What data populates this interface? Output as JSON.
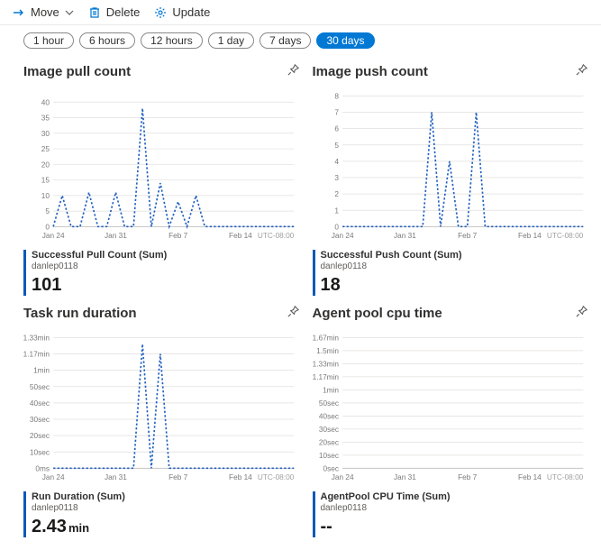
{
  "toolbar": {
    "move_label": "Move",
    "delete_label": "Delete",
    "update_label": "Update"
  },
  "time_ranges": [
    "1 hour",
    "6 hours",
    "12 hours",
    "1 day",
    "7 days",
    "30 days"
  ],
  "time_range_active_index": 5,
  "timezone_label": "UTC-08:00",
  "colors": {
    "series_primary": "#2060c0",
    "grid": "#e1dfdd",
    "axis_text": "#7a7a7a"
  },
  "charts": [
    {
      "title": "Image pull count",
      "metric_name": "Successful Pull Count (Sum)",
      "resource": "danlep0118",
      "value": "101",
      "unit": "",
      "chart_data": {
        "type": "line",
        "x": [
          "Jan 24",
          "Jan 25",
          "Jan 26",
          "Jan 27",
          "Jan 28",
          "Jan 29",
          "Jan 30",
          "Jan 31",
          "Feb 1",
          "Feb 2",
          "Feb 3",
          "Feb 4",
          "Feb 5",
          "Feb 6",
          "Feb 7",
          "Feb 8",
          "Feb 9",
          "Feb 10",
          "Feb 11",
          "Feb 12",
          "Feb 13",
          "Feb 14",
          "Feb 15",
          "Feb 16",
          "Feb 17",
          "Feb 18",
          "Feb 19",
          "Feb 20"
        ],
        "values": [
          0,
          10,
          0,
          0,
          11,
          0,
          0,
          11,
          0,
          0,
          38,
          0,
          14,
          0,
          8,
          0,
          10,
          0,
          0,
          0,
          0,
          0,
          0,
          0,
          0,
          0,
          0,
          0
        ],
        "yticks": [
          0,
          5,
          10,
          15,
          20,
          25,
          30,
          35,
          40
        ],
        "xticks": [
          "Jan 24",
          "Jan 31",
          "Feb 7",
          "Feb 14"
        ],
        "ylim": [
          0,
          42
        ]
      }
    },
    {
      "title": "Image push count",
      "metric_name": "Successful Push Count (Sum)",
      "resource": "danlep0118",
      "value": "18",
      "unit": "",
      "chart_data": {
        "type": "line",
        "x": [
          "Jan 24",
          "Jan 25",
          "Jan 26",
          "Jan 27",
          "Jan 28",
          "Jan 29",
          "Jan 30",
          "Jan 31",
          "Feb 1",
          "Feb 2",
          "Feb 3",
          "Feb 4",
          "Feb 5",
          "Feb 6",
          "Feb 7",
          "Feb 8",
          "Feb 9",
          "Feb 10",
          "Feb 11",
          "Feb 12",
          "Feb 13",
          "Feb 14",
          "Feb 15",
          "Feb 16",
          "Feb 17",
          "Feb 18",
          "Feb 19",
          "Feb 20"
        ],
        "values": [
          0,
          0,
          0,
          0,
          0,
          0,
          0,
          0,
          0,
          0,
          7,
          0,
          4,
          0,
          0,
          7,
          0,
          0,
          0,
          0,
          0,
          0,
          0,
          0,
          0,
          0,
          0,
          0
        ],
        "yticks": [
          0,
          1,
          2,
          3,
          4,
          5,
          6,
          7,
          8
        ],
        "xticks": [
          "Jan 24",
          "Jan 31",
          "Feb 7",
          "Feb 14"
        ],
        "ylim": [
          0,
          8
        ]
      }
    },
    {
      "title": "Task run duration",
      "metric_name": "Run Duration (Sum)",
      "resource": "danlep0118",
      "value": "2.43",
      "unit": "min",
      "chart_data": {
        "type": "line",
        "x": [
          "Jan 24",
          "Jan 25",
          "Jan 26",
          "Jan 27",
          "Jan 28",
          "Jan 29",
          "Jan 30",
          "Jan 31",
          "Feb 1",
          "Feb 2",
          "Feb 3",
          "Feb 4",
          "Feb 5",
          "Feb 6",
          "Feb 7",
          "Feb 8",
          "Feb 9",
          "Feb 10",
          "Feb 11",
          "Feb 12",
          "Feb 13",
          "Feb 14",
          "Feb 15",
          "Feb 16",
          "Feb 17",
          "Feb 18",
          "Feb 19",
          "Feb 20"
        ],
        "values_sec": [
          0,
          0,
          0,
          0,
          0,
          0,
          0,
          0,
          0,
          0,
          76,
          0,
          70,
          0,
          0,
          0,
          0,
          0,
          0,
          0,
          0,
          0,
          0,
          0,
          0,
          0,
          0,
          0
        ],
        "yticks": [
          "0ms",
          "10sec",
          "20sec",
          "30sec",
          "40sec",
          "50sec",
          "1min",
          "1.17min",
          "1.33min"
        ],
        "ytick_vals_sec": [
          0,
          10,
          20,
          30,
          40,
          50,
          60,
          70,
          80
        ],
        "xticks": [
          "Jan 24",
          "Jan 31",
          "Feb 7",
          "Feb 14"
        ],
        "ylim_sec": [
          0,
          80
        ]
      }
    },
    {
      "title": "Agent pool cpu time",
      "metric_name": "AgentPool CPU Time (Sum)",
      "resource": "danlep0118",
      "value": "--",
      "unit": "",
      "chart_data": {
        "type": "line",
        "x": [
          "Jan 24",
          "Jan 25",
          "Jan 26",
          "Jan 27",
          "Jan 28",
          "Jan 29",
          "Jan 30",
          "Jan 31",
          "Feb 1",
          "Feb 2",
          "Feb 3",
          "Feb 4",
          "Feb 5",
          "Feb 6",
          "Feb 7",
          "Feb 8",
          "Feb 9",
          "Feb 10",
          "Feb 11",
          "Feb 12",
          "Feb 13",
          "Feb 14",
          "Feb 15",
          "Feb 16",
          "Feb 17",
          "Feb 18",
          "Feb 19",
          "Feb 20"
        ],
        "values_sec": [],
        "yticks": [
          "0sec",
          "10sec",
          "20sec",
          "30sec",
          "40sec",
          "50sec",
          "1min",
          "1.17min",
          "1.33min",
          "1.5min",
          "1.67min"
        ],
        "ytick_vals_sec": [
          0,
          10,
          20,
          30,
          40,
          50,
          60,
          70,
          80,
          90,
          100
        ],
        "xticks": [
          "Jan 24",
          "Jan 31",
          "Feb 7",
          "Feb 14"
        ],
        "ylim_sec": [
          0,
          100
        ]
      }
    }
  ]
}
